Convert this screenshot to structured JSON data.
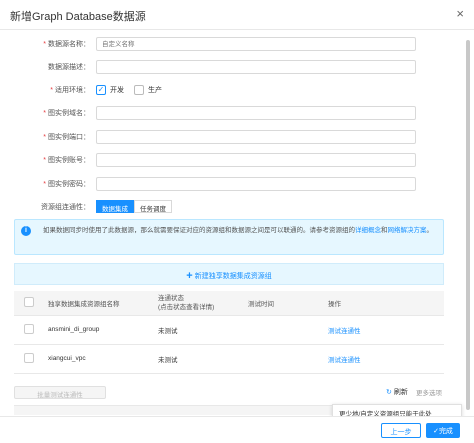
{
  "dialog": {
    "title": "新增Graph Database数据源",
    "close_label": "×"
  },
  "form": {
    "name": {
      "label": "数据源名称：",
      "required": "*",
      "placeholder": "自定义名称"
    },
    "desc": {
      "label": "数据源描述："
    },
    "env": {
      "label": "适用环境：",
      "required": "*",
      "dev_label": "开发",
      "prod_label": "生产",
      "dev_checked": true,
      "prod_checked": false
    },
    "host": {
      "label": "图实例域名：",
      "required": "*"
    },
    "port": {
      "label": "图实例端口：",
      "required": "*"
    },
    "account": {
      "label": "图实例账号：",
      "required": "*"
    },
    "password": {
      "label": "图实例密码：",
      "required": "*"
    },
    "connectivity": {
      "label": "资源组连通性：",
      "tabs": [
        "数据集成",
        "任务调度"
      ],
      "active_tab": 0
    }
  },
  "notice": {
    "text": "如果数据同步时使用了此数据源，那么就需要保证对应的资源组和数据源之间是可以联通的。请参考资源组的",
    "link1": "详细概念",
    "mid": "和",
    "link2": "网络解决方案",
    "end": "。"
  },
  "new_group": {
    "label": "新建独享数据集成资源组"
  },
  "table": {
    "headers": [
      "独享数据集成资源组名称",
      "连通状态\n(点击状态查看详情)",
      "测试时间",
      "操作"
    ],
    "header_status": "连通状态",
    "header_status_sub": "(点击状态查看详情)",
    "rows": [
      {
        "name": "ansmini_di_group",
        "status": "未测试",
        "time": "",
        "action": "测试连通性"
      },
      {
        "name": "xiangcui_vpc",
        "status": "未测试",
        "time": "",
        "action": "测试连通性"
      }
    ]
  },
  "bottom": {
    "batch_label": "批量测试连通性",
    "refresh_label": "刷新",
    "more_label": "更多选项"
  },
  "tooltip": {
    "text": "更少地/自定义资源组只能于此处"
  },
  "footer": {
    "prev_label": "上一步",
    "done_label": "完成"
  },
  "colors": {
    "primary": "#1890ff",
    "notice_bg": "#e6f7ff",
    "required": "#e4393c"
  }
}
